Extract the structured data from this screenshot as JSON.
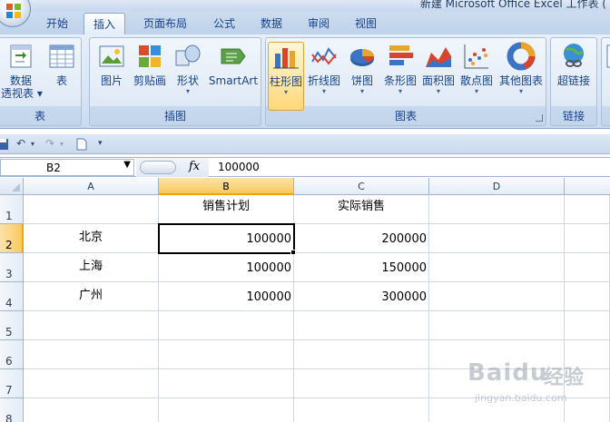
{
  "window": {
    "title": "新建 Microsoft Office Excel 工作表 ("
  },
  "tabs": [
    {
      "label": "开始"
    },
    {
      "label": "插入"
    },
    {
      "label": "页面布局"
    },
    {
      "label": "公式"
    },
    {
      "label": "数据"
    },
    {
      "label": "审阅"
    },
    {
      "label": "视图"
    }
  ],
  "ribbon": {
    "groups": {
      "tables": {
        "label": "表",
        "items": [
          "数据透视表",
          "表"
        ]
      },
      "illustrations": {
        "label": "插图",
        "items": [
          "图片",
          "剪贴画",
          "形状",
          "SmartArt"
        ]
      },
      "charts": {
        "label": "图表",
        "items": [
          "柱形图",
          "折线图",
          "饼图",
          "条形图",
          "面积图",
          "散点图",
          "其他图表"
        ]
      },
      "links": {
        "label": "链接",
        "items": [
          "超链接"
        ]
      },
      "text": {
        "items": [
          "文"
        ]
      }
    },
    "pivot_line1": "数据",
    "pivot_line2": "透视表"
  },
  "formula_bar": {
    "name_box": "B2",
    "fx": "fx",
    "value": "100000"
  },
  "sheet": {
    "columns": [
      "A",
      "B",
      "C",
      "D"
    ],
    "rows": [
      "1",
      "2",
      "3",
      "4",
      "5",
      "6",
      "7",
      "8"
    ],
    "cells": {
      "B1": "销售计划",
      "C1": "实际销售",
      "A2": "北京",
      "B2": "100000",
      "C2": "200000",
      "A3": "上海",
      "B3": "100000",
      "C3": "150000",
      "A4": "广州",
      "B4": "100000",
      "C4": "300000"
    },
    "active_cell": "B2"
  },
  "watermark": {
    "main": "Baidu",
    "cn": "经验",
    "url": "jingyan.baidu.com"
  },
  "colors": {
    "accent": "#15428b",
    "selection": "#f8c860"
  }
}
